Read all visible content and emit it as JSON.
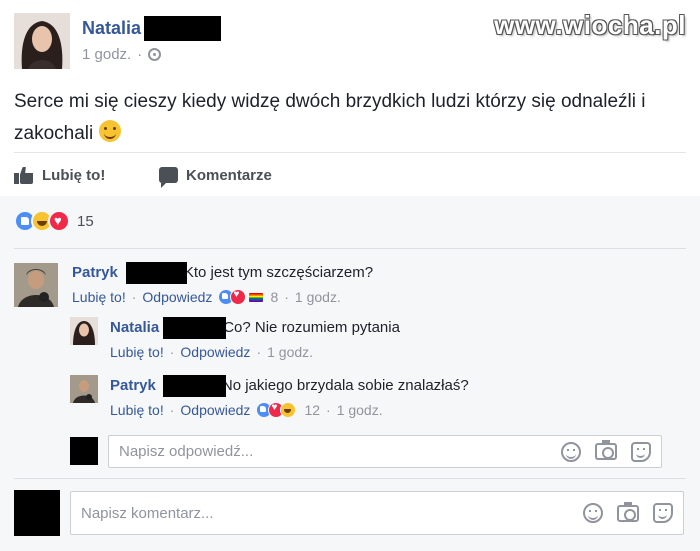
{
  "post": {
    "author": "Natalia",
    "time": "1 godz.",
    "text": "Serce mi się cieszy kiedy widzę dwóch brzydkich ludzi którzy się odnaleźli i zakochali",
    "watermark": "www.wiocha.pl"
  },
  "actions": {
    "like_label": "Lubię to!",
    "comment_label": "Komentarze"
  },
  "reactions": {
    "count": "15",
    "types": [
      "like",
      "haha",
      "love"
    ]
  },
  "comments": [
    {
      "author": "Patryk",
      "text": "Kto jest tym szczęściarzem?",
      "like": "Lubię to!",
      "reply": "Odpowiedz",
      "reaction_types": [
        "like",
        "love",
        "rainbow"
      ],
      "reaction_count": "8",
      "time": "1 godz."
    },
    {
      "author": "Natalia",
      "text": "Co? Nie rozumiem pytania",
      "like": "Lubię to!",
      "reply": "Odpowiedz",
      "time": "1 godz."
    },
    {
      "author": "Patryk",
      "text": "No jakiego brzydala sobie znalazłaś?",
      "like": "Lubię to!",
      "reply": "Odpowiedz",
      "reaction_types": [
        "like",
        "love",
        "haha"
      ],
      "reaction_count": "12",
      "time": "1 godz."
    }
  ],
  "reply_box": {
    "placeholder": "Napisz odpowiedź..."
  },
  "comment_box": {
    "placeholder": "Napisz komentarz..."
  },
  "separator": "·",
  "icons": [
    "globe-icon",
    "like-icon",
    "comment-icon",
    "emoji-icon",
    "camera-icon",
    "sticker-icon"
  ]
}
